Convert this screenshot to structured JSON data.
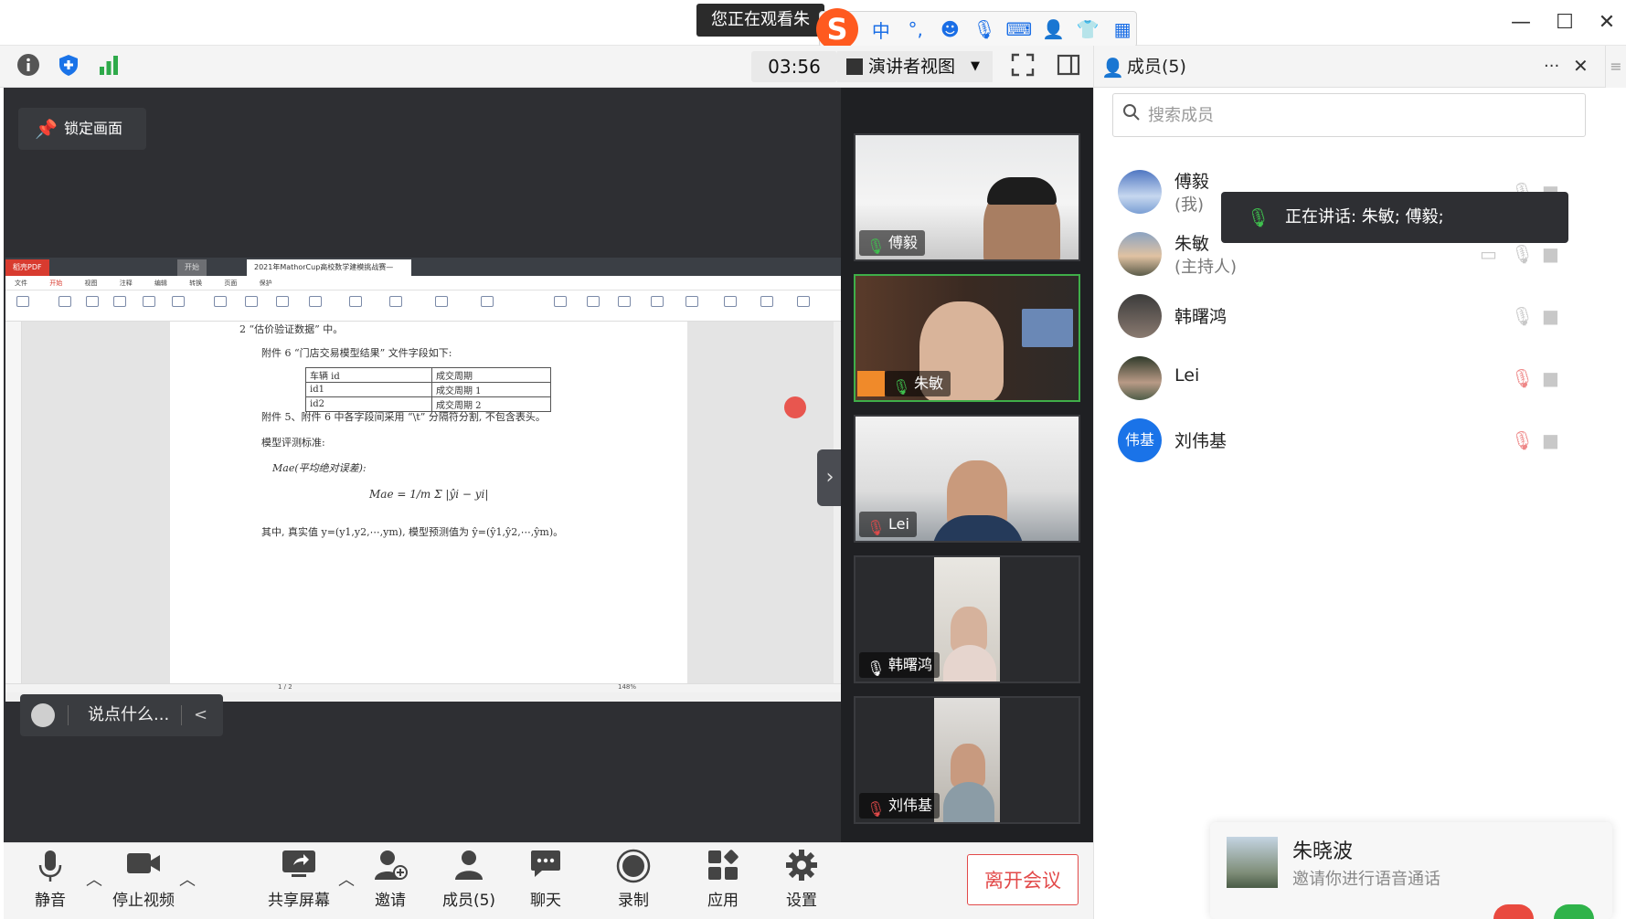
{
  "titlebar": {
    "notice": "您正在观看朱",
    "ime": {
      "logo": "S",
      "items": [
        "中",
        "°,",
        "☻",
        "🎙",
        "⌨",
        "👤",
        "👕",
        "▦"
      ]
    },
    "window_controls": [
      "—",
      "☐",
      "✕"
    ]
  },
  "toolbar": {
    "icons": [
      "info-icon",
      "shield-icon",
      "signal-icon"
    ],
    "timer": "03:56",
    "view_mode": "演讲者视图",
    "view_mode_caret": "▼"
  },
  "stage": {
    "pin_label": "锁定画面",
    "chat_placeholder": "说点什么...",
    "chat_arrow": "<",
    "collapse_arrow": "›"
  },
  "pdf": {
    "tabs": [
      "稻壳PDF",
      "开始",
      "2021年MathorCup高校数学建模挑战赛—"
    ],
    "menu": [
      "文件",
      "开始",
      "视图",
      "注释",
      "编辑",
      "转换",
      "页面",
      "保护"
    ],
    "lines": [
      "2 “估价验证数据” 中。",
      "附件 6 “门店交易模型结果” 文件字段如下:",
      "附件 5、附件 6 中各字段间采用 “\\t” 分隔符分割, 不包含表头。",
      "模型评测标准:",
      "Mae(平均绝对误差):",
      "Mae = 1/m Σ |ŷi − yi|",
      "其中, 真实值 y=(y1,y2,⋯,ym), 模型预测值为 ŷ=(ŷ1,ŷ2,⋯,ŷm)。"
    ],
    "table": [
      [
        "车辆 id",
        "成交周期"
      ],
      [
        "id1",
        "成交周期 1"
      ],
      [
        "id2",
        "成交周期 2"
      ]
    ],
    "page_indicator": "1 / 2",
    "zoom": "148%"
  },
  "videos": [
    {
      "name": "傅毅",
      "mic": "on",
      "host": false,
      "active": false
    },
    {
      "name": "朱敏",
      "mic": "on",
      "host": true,
      "active": true
    },
    {
      "name": "Lei",
      "mic": "muted",
      "host": false,
      "active": false
    },
    {
      "name": "韩曙鸿",
      "mic": "on",
      "host": false,
      "active": false
    },
    {
      "name": "刘伟基",
      "mic": "muted",
      "host": false,
      "active": false
    }
  ],
  "panel": {
    "title": "成员(5)",
    "more": "···",
    "close": "✕",
    "search_placeholder": "搜索成员",
    "members": [
      {
        "name": "傅毅",
        "role": "(我)",
        "avatar_text": "",
        "avatar_color": "#6b8fc7"
      },
      {
        "name": "朱敏",
        "role": "(主持人)",
        "avatar_text": "",
        "avatar_color": "#8a9aa8"
      },
      {
        "name": "韩曙鸿",
        "role": "",
        "avatar_text": "",
        "avatar_color": "#5a5a5a"
      },
      {
        "name": "Lei",
        "role": "",
        "avatar_text": "",
        "avatar_color": "#6d7a6a"
      },
      {
        "name": "刘伟基",
        "role": "",
        "avatar_text": "伟基",
        "avatar_color": "#1a73e8"
      }
    ],
    "speaking": "正在讲话: 朱敏; 傅毅;"
  },
  "invite": {
    "name": "朱晓波",
    "message": "邀请你进行语音通话"
  },
  "controls": {
    "mute": "静音",
    "stop_video": "停止视频",
    "share_screen": "共享屏幕",
    "invite": "邀请",
    "members": "成员(5)",
    "chat": "聊天",
    "record": "录制",
    "apps": "应用",
    "settings": "设置",
    "leave": "离开会议"
  },
  "colors": {
    "active_speaker": "#3fae49",
    "leave": "#e24a4a",
    "accent": "#1a73e8"
  }
}
